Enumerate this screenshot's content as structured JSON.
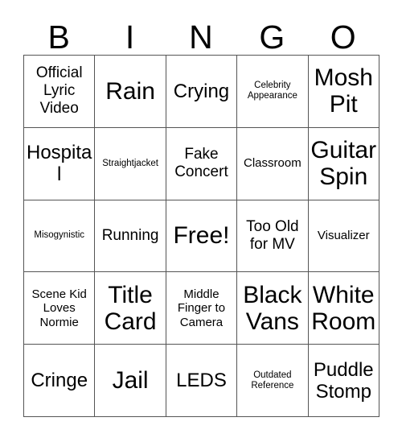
{
  "card": {
    "title": "BINGO",
    "header_letters": [
      "B",
      "I",
      "N",
      "G",
      "O"
    ],
    "grid_line_color": "#555555",
    "text_color": "#000000",
    "background_color": "#ffffff",
    "rows": 5,
    "columns": 5,
    "cells": [
      [
        {
          "label": "Official Lyric Video",
          "size": "size-m"
        },
        {
          "label": "Rain",
          "size": "size-xl"
        },
        {
          "label": "Crying",
          "size": "size-l"
        },
        {
          "label": "Celebrity Appearance",
          "size": "size-xs"
        },
        {
          "label": "Mosh Pit",
          "size": "size-xl"
        }
      ],
      [
        {
          "label": "Hospital",
          "size": "size-l"
        },
        {
          "label": "Straightjacket",
          "size": "size-xs"
        },
        {
          "label": "Fake Concert",
          "size": "size-m"
        },
        {
          "label": "Classroom",
          "size": "size-s"
        },
        {
          "label": "Guitar Spin",
          "size": "size-xl"
        }
      ],
      [
        {
          "label": "Misogynistic",
          "size": "size-xs"
        },
        {
          "label": "Running",
          "size": "size-m"
        },
        {
          "label": "Free!",
          "size": "size-xl"
        },
        {
          "label": "Too Old for MV",
          "size": "size-m"
        },
        {
          "label": "Visualizer",
          "size": "size-s"
        }
      ],
      [
        {
          "label": "Scene Kid Loves Normie",
          "size": "size-s"
        },
        {
          "label": "Title Card",
          "size": "size-xl"
        },
        {
          "label": "Middle Finger to Camera",
          "size": "size-s"
        },
        {
          "label": "Black Vans",
          "size": "size-xl"
        },
        {
          "label": "White Room",
          "size": "size-xl"
        }
      ],
      [
        {
          "label": "Cringe",
          "size": "size-l"
        },
        {
          "label": "Jail",
          "size": "size-xl"
        },
        {
          "label": "LEDS",
          "size": "size-l"
        },
        {
          "label": "Outdated Reference",
          "size": "size-xs"
        },
        {
          "label": "Puddle Stomp",
          "size": "size-l"
        }
      ]
    ]
  }
}
